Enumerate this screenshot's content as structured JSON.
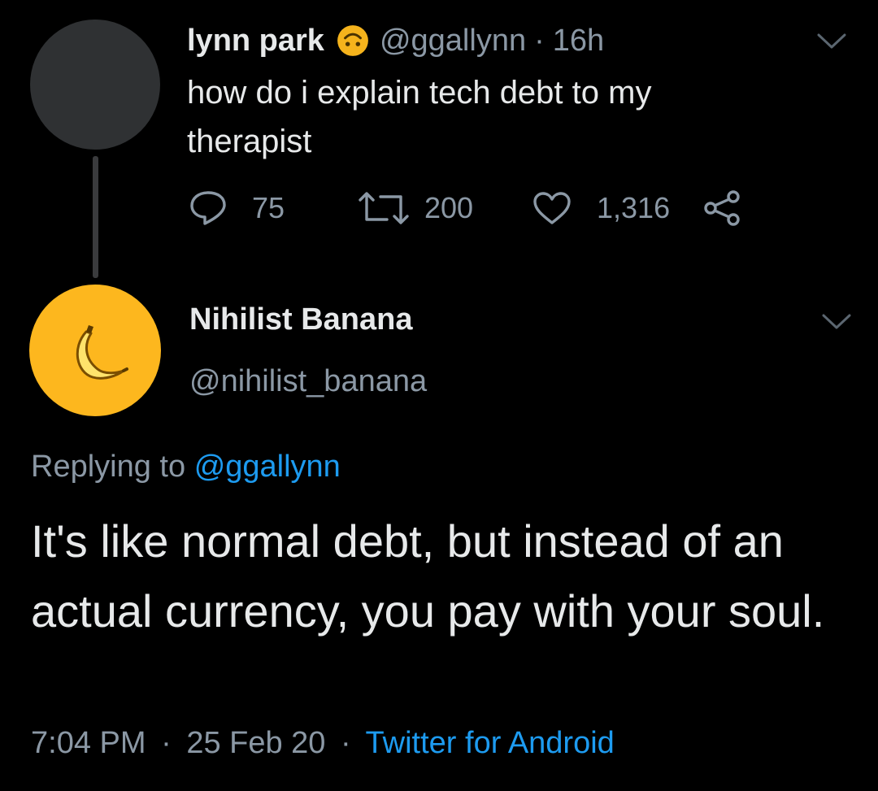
{
  "colors": {
    "background": "#000000",
    "text_primary": "#e7e9ea",
    "text_muted": "#8b98a5",
    "link": "#1d9bf0",
    "parent_avatar": "#2f3133",
    "reply_avatar": "#fdb71e"
  },
  "parent_tweet": {
    "author_name": "lynn park",
    "author_emoji_icon": "upside-down-face-icon",
    "handle": "@ggallynn",
    "separator": "·",
    "time": "16h",
    "text": "how do i explain tech debt to my therapist",
    "menu_icon": "chevron-down-icon",
    "actions": {
      "reply_count": "75",
      "retweet_count": "200",
      "like_count": "1,316",
      "share_icon": "share-icon"
    }
  },
  "reply_tweet": {
    "avatar_icon": "banana-icon",
    "author_name": "Nihilist Banana",
    "handle": "@nihilist_banana",
    "menu_icon": "chevron-down-icon",
    "replying_to_label": "Replying to",
    "replying_to_handle": "@ggallynn",
    "text": "It's like normal debt, but instead of an actual currency, you pay with your soul.",
    "time": "7:04 PM",
    "date": "25 Feb 20",
    "separator": "·",
    "client": "Twitter for Android"
  }
}
